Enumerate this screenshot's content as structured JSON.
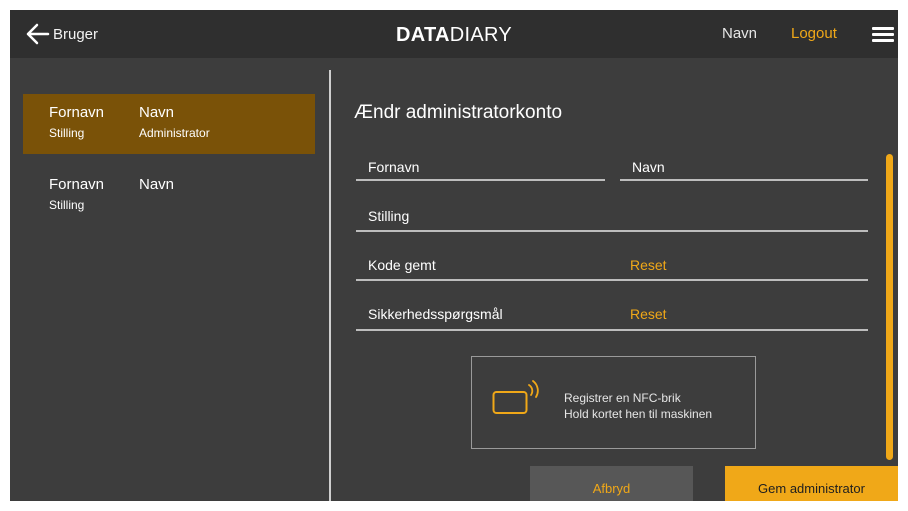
{
  "header": {
    "back_label": "Bruger",
    "logo_bold": "DATA",
    "logo_light": "DIARY",
    "user_name": "Navn",
    "logout_label": "Logout"
  },
  "colors": {
    "accent": "#f0a818",
    "selected_row": "#7a5208",
    "background": "#3d3d3d",
    "topbar": "#2f2f2f"
  },
  "users": [
    {
      "first_name": "Fornavn",
      "last_name": "Navn",
      "position": "Stilling",
      "role": "Administrator",
      "selected": true
    },
    {
      "first_name": "Fornavn",
      "last_name": "Navn",
      "position": "Stilling",
      "role": "",
      "selected": false
    }
  ],
  "form": {
    "title": "Ændr administratorkonto",
    "first_name_label": "Fornavn",
    "last_name_label": "Navn",
    "position_label": "Stilling",
    "password_label": "Kode gemt",
    "password_reset": "Reset",
    "security_label": "Sikkerhedsspørgsmål",
    "security_reset": "Reset"
  },
  "nfc": {
    "line1": "Registrer en NFC-brik",
    "line2": "Hold kortet hen til maskinen"
  },
  "actions": {
    "cancel_label": "Afbryd",
    "save_label": "Gem administrator"
  },
  "icons": {
    "back": "arrow-left-icon",
    "menu": "hamburger-menu-icon",
    "nfc": "nfc-card-icon"
  }
}
